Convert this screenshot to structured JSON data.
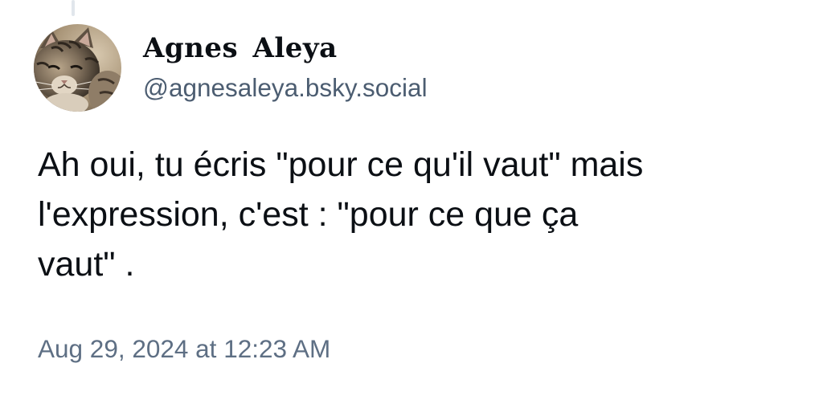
{
  "post": {
    "author": {
      "display_name": "Agnes  Aleya",
      "handle": "@agnesaleya.bsky.social",
      "avatar_icon": "cat-photo-avatar"
    },
    "text_lines": [
      "Ah oui, tu écris \"pour ce qu'il vaut\" mais",
      "l'expression, c'est : \"pour ce que ça",
      "vaut\" ."
    ],
    "timestamp": "Aug 29, 2024 at 12:23 AM"
  },
  "colors": {
    "text_primary": "#0b0f14",
    "text_secondary": "#4c5d71",
    "thread_line": "#e1e6ec",
    "background": "#ffffff"
  }
}
